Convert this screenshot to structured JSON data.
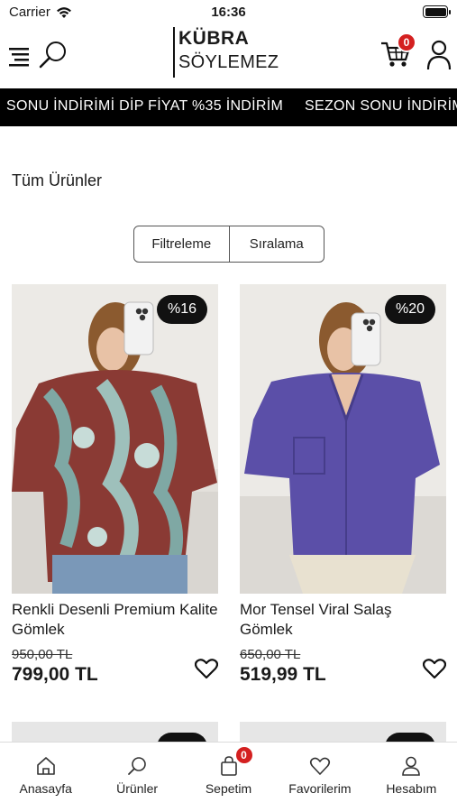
{
  "status_bar": {
    "carrier": "Carrier",
    "time": "16:36"
  },
  "header": {
    "logo_line1": "KÜBRA",
    "logo_line2": "SÖYLEMEZ",
    "cart_count": "0",
    "icons": [
      "menu-icon",
      "search-icon",
      "cart-icon",
      "user-icon"
    ]
  },
  "announcement": {
    "text1": "SONU İNDİRİMİ DİP FİYAT %35 İNDİRİM",
    "text2": "SEZON SONU İNDİRİM"
  },
  "page": {
    "title": "Tüm Ürünler"
  },
  "filters": {
    "filter_label": "Filtreleme",
    "sort_label": "Sıralama"
  },
  "products": [
    {
      "discount": "%16",
      "name": "Renkli Desenli Premium Kalite Gömlek",
      "old_price": "950,00 TL",
      "price": "799,00 TL",
      "shirt_color": "#8a3a34"
    },
    {
      "discount": "%20",
      "name": "Mor Tensel Viral Salaş Gömlek",
      "old_price": "650,00 TL",
      "price": "519,99 TL",
      "shirt_color": "#5b4fa8"
    }
  ],
  "tab_bar": {
    "items": [
      {
        "label": "Anasayfa",
        "icon": "home-icon"
      },
      {
        "label": "Ürünler",
        "icon": "search-icon"
      },
      {
        "label": "Sepetim",
        "icon": "bag-icon",
        "badge": "0"
      },
      {
        "label": "Favorilerim",
        "icon": "heart-icon"
      },
      {
        "label": "Hesabım",
        "icon": "user-icon"
      }
    ]
  },
  "colors": {
    "accent": "#000000",
    "badge": "#d42020"
  }
}
